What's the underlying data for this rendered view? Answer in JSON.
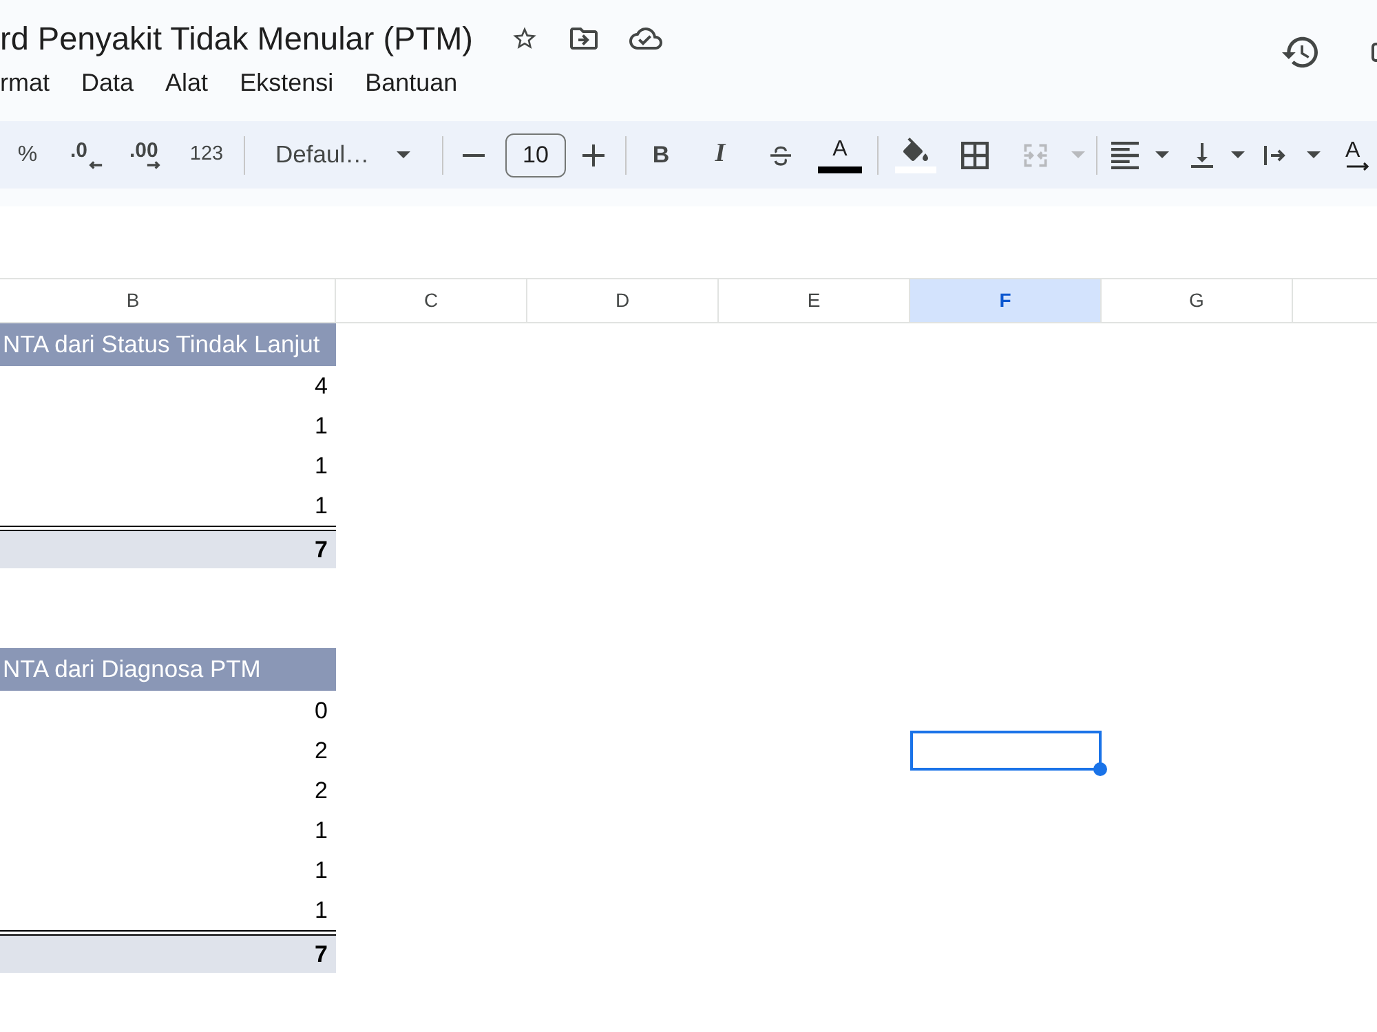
{
  "document": {
    "title": "rd Penyakit Tidak Menular (PTM)"
  },
  "menu": [
    "rmat",
    "Data",
    "Alat",
    "Ekstensi",
    "Bantuan"
  ],
  "toolbar": {
    "percent": "%",
    "decrease_decimal": ".0",
    "increase_decimal": ".00",
    "number_format": "123",
    "font": "Defaul…",
    "font_size": "10",
    "bold": "B",
    "italic": "I",
    "text_color": {
      "label": "A",
      "color": "#000000"
    },
    "fill_color": {
      "color": "#ffffff"
    },
    "merge": {
      "disabled": true
    },
    "rotation": "A"
  },
  "sheet": {
    "columns": [
      {
        "label": "B",
        "selected": false
      },
      {
        "label": "C",
        "selected": false
      },
      {
        "label": "D",
        "selected": false
      },
      {
        "label": "E",
        "selected": false
      },
      {
        "label": "F",
        "selected": true
      },
      {
        "label": "G",
        "selected": false
      }
    ],
    "rows": [
      {
        "kind": "header",
        "text": "NTA dari Status Tindak Lanjut",
        "selected": false
      },
      {
        "kind": "value",
        "text": "4",
        "selected": false
      },
      {
        "kind": "value",
        "text": "1",
        "selected": false
      },
      {
        "kind": "value",
        "text": "1",
        "selected": false
      },
      {
        "kind": "value",
        "text": "1",
        "selected": false
      },
      {
        "kind": "total",
        "text": "7",
        "selected": false
      },
      {
        "kind": "empty",
        "selected": false
      },
      {
        "kind": "empty",
        "selected": false
      },
      {
        "kind": "header",
        "text": "NTA dari Diagnosa PTM",
        "selected": false
      },
      {
        "kind": "value",
        "text": "0",
        "selected": false
      },
      {
        "kind": "value",
        "text": "2",
        "selected": true
      },
      {
        "kind": "value",
        "text": "2",
        "selected": false
      },
      {
        "kind": "value",
        "text": "1",
        "selected": false
      },
      {
        "kind": "value",
        "text": "1",
        "selected": false
      },
      {
        "kind": "value",
        "text": "1",
        "selected": false
      },
      {
        "kind": "total",
        "text": "7",
        "selected": false
      }
    ]
  }
}
